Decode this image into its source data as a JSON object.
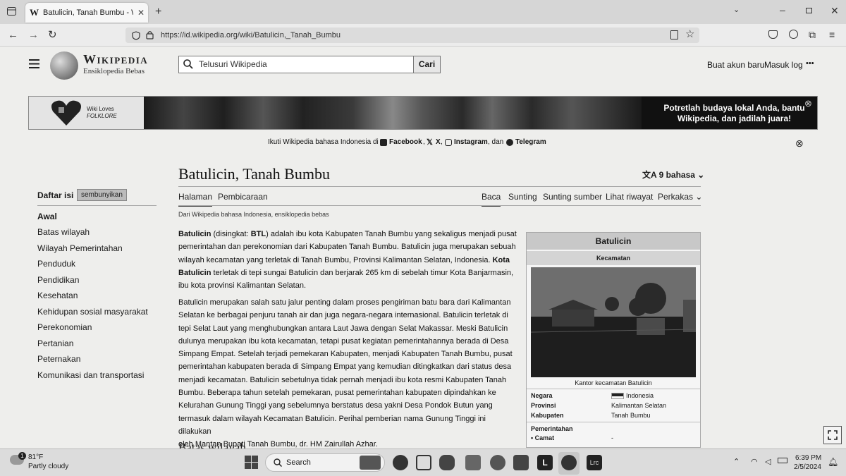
{
  "browser": {
    "tab_title": "Batulicin, Tanah Bumbu - Wikipe",
    "tab_favicon": "W",
    "url": "https://id.wikipedia.org/wiki/Batulicin,_Tanah_Bumbu"
  },
  "wiki": {
    "logo_title": "Wikipedia",
    "logo_subtitle": "Ensiklopedia Bebas",
    "search_placeholder": "Telusuri Wikipedia",
    "search_button": "Cari",
    "create_account": "Buat akun baru",
    "login": "Masuk log",
    "more": "•••"
  },
  "banner": {
    "logo_line1": "Wiki Loves",
    "logo_line2": "FOLKLORE",
    "text": "Potretlah budaya lokal Anda, bantu Wikipedia, dan jadilah juara!",
    "close": "⊗"
  },
  "follow": {
    "prefix": "Ikuti Wikipedia bahasa Indonesia di",
    "facebook": "Facebook",
    "x": "X",
    "instagram": "Instagram",
    "and": ", dan",
    "telegram": "Telegram",
    "close": "⊗"
  },
  "article": {
    "title": "Batulicin, Tanah Bumbu",
    "languages": "9 bahasa",
    "tabs_left": [
      "Halaman",
      "Pembicaraan"
    ],
    "tabs_right": [
      "Baca",
      "Sunting",
      "Sunting sumber",
      "Lihat riwayat",
      "Perkakas"
    ],
    "from": "Dari Wikipedia bahasa Indonesia, ensiklopedia bebas",
    "p1_lines": [
      "<b>Batulicin</b> (disingkat: <b>BTL</b>) adalah ibu kota Kabupaten Tanah Bumbu yang sekaligus menjadi pusat",
      "pemerintahan dan perekonomian dari Kabupaten Tanah Bumbu. Batulicin juga merupakan sebuah",
      "wilayah kecamatan yang terletak di Tanah Bumbu, Provinsi Kalimantan Selatan, Indonesia. <b>Kota</b>",
      "<b>Batulicin</b> terletak di tepi sungai Batulicin dan berjarak 265 km di sebelah timur Kota Banjarmasin,",
      "ibu kota provinsi Kalimantan Selatan."
    ],
    "p2_lines": [
      "Batulicin merupakan salah satu jalur penting dalam proses pengiriman batu bara dari Kalimantan",
      "Selatan ke berbagai penjuru tanah air dan juga negara-negara internasional. Batulicin terletak di",
      "tepi Selat Laut yang menghubungkan antara Laut Jawa dengan Selat Makassar. Meski Batulicin",
      "dulunya merupakan ibu kota kecamatan, tetapi pusat kegiatan pemerintahannya berada di Desa",
      "Simpang Empat. Setelah terjadi pemekaran Kabupaten, menjadi Kabupaten Tanah Bumbu, pusat",
      "pemerintahan kabupaten berada di Simpang Empat yang kemudian ditingkatkan dari status desa",
      "menjadi kecamatan. Batulicin sebetulnya tidak pernah menjadi ibu kota resmi Kabupaten Tanah",
      "Bumbu. Beberapa tahun setelah pemekaran, pusat pemerintahan kabupaten dipindahkan ke",
      "Kelurahan Gunung Tinggi yang sebelumnya berstatus desa yakni Desa Pondok Butun yang",
      "termasuk dalam wilayah Kecamatan Batulicin. Perihal pemberian nama Gunung Tinggi ini dilakukan",
      "oleh Mantan Bupati Tanah Bumbu, dr. HM Zairullah Azhar."
    ],
    "next_heading": "Batas wilayah"
  },
  "toc": {
    "heading": "Daftar isi",
    "hide": "sembunyikan",
    "items": [
      "Awal",
      "Batas wilayah",
      "Wilayah Pemerintahan",
      "Penduduk",
      "Pendidikan",
      "Kesehatan",
      "Kehidupan sosial masyarakat",
      "Perekonomian",
      "Pertanian",
      "Peternakan",
      "Komunikasi dan transportasi"
    ]
  },
  "infobox": {
    "title": "Batulicin",
    "subtitle": "Kecamatan",
    "caption": "Kantor kecamatan Batulicin",
    "rows": [
      {
        "k": "Negara",
        "v": "Indonesia"
      },
      {
        "k": "Provinsi",
        "v": "Kalimantan Selatan"
      },
      {
        "k": "Kabupaten",
        "v": "Tanah Bumbu"
      }
    ],
    "gov_heading": "Pemerintahan",
    "camat_label": "• Camat",
    "camat_value": "-"
  },
  "taskbar": {
    "weather_badge": "1",
    "temp": "81°F",
    "condition": "Partly cloudy",
    "search": "Search",
    "time": "6:39 PM",
    "date": "2/5/2024"
  }
}
